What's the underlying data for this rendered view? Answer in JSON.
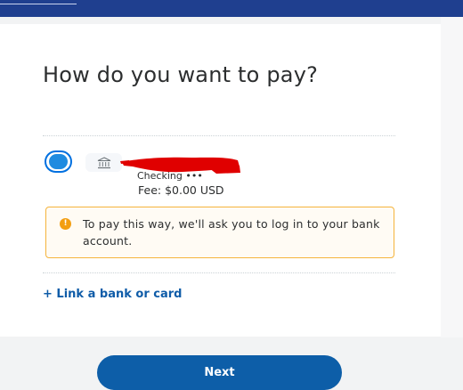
{
  "page": {
    "title": "How do you want to pay?"
  },
  "payment_option": {
    "selected": true,
    "icon": "bank-icon",
    "account_type": "Checking •••",
    "fee": "Fee: $0.00 USD",
    "notice": "To pay this way, we'll ask you to log in to your bank account.",
    "notice_icon": "warning-icon"
  },
  "actions": {
    "link_label": "+ Link a bank or card",
    "next_label": "Next"
  },
  "colors": {
    "header": "#1f3f8f",
    "accent": "#0d5ea8",
    "radio": "#1f8be0",
    "notice_border": "#f5b43c",
    "warning_icon": "#f39e11",
    "redaction": "#e00000"
  }
}
